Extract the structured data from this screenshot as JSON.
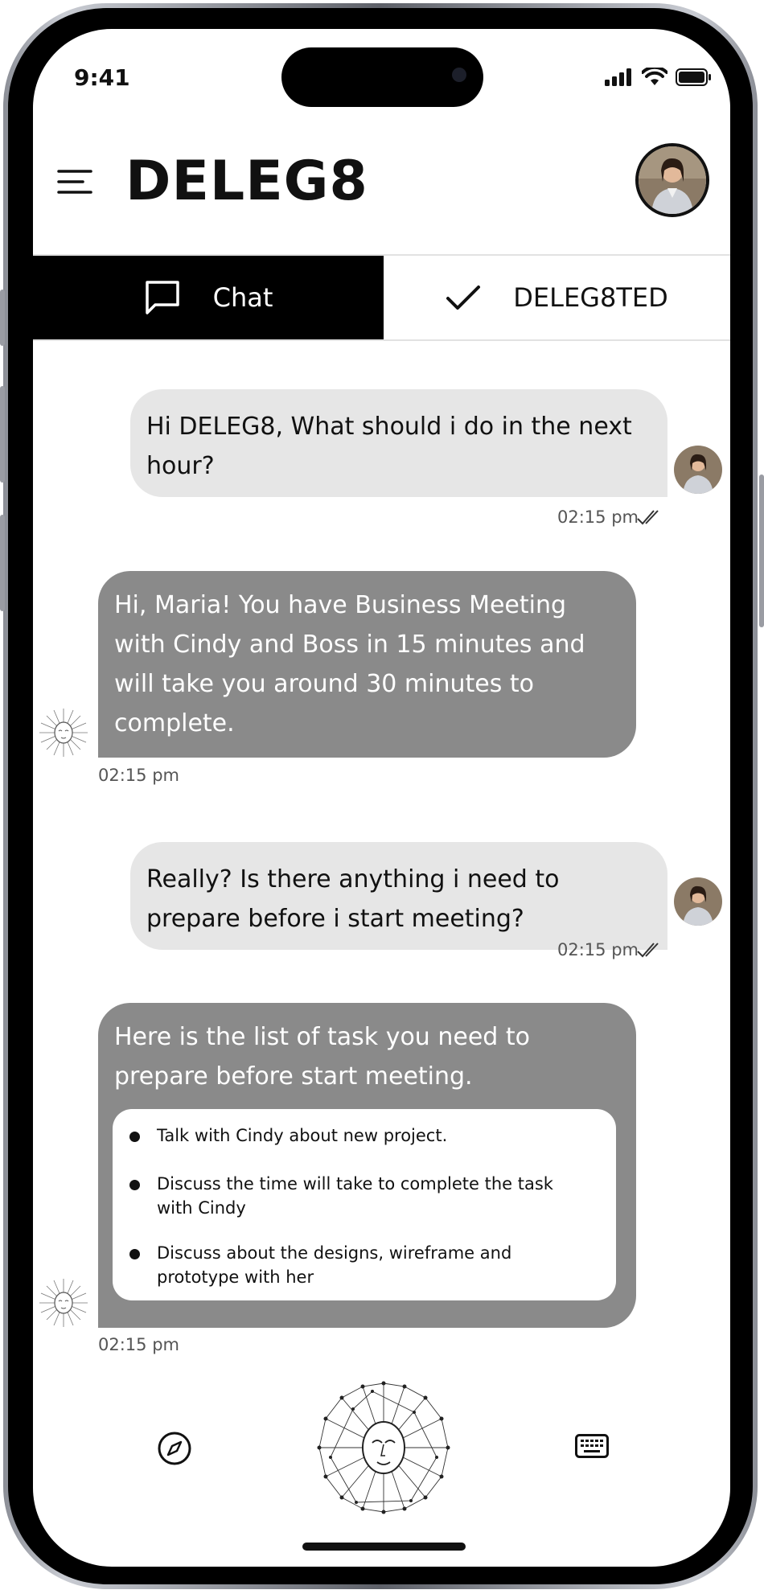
{
  "status_bar": {
    "time": "9:41"
  },
  "app": {
    "brand": "DELEG8"
  },
  "tabs": [
    {
      "label": "Chat",
      "active": true
    },
    {
      "label": "DELEG8TED",
      "active": false
    }
  ],
  "messages": [
    {
      "sender": "user",
      "text": "Hi DELEG8, What should i do in the next hour?",
      "time": "02:15 pm"
    },
    {
      "sender": "bot",
      "text": "Hi, Maria! You have Business Meeting with Cindy and Boss in 15 minutes and will take you around 30 minutes to complete.",
      "time": "02:15 pm"
    },
    {
      "sender": "user",
      "text": "Really? Is there anything i need to prepare before i start meeting?",
      "time": "02:15 pm"
    },
    {
      "sender": "bot",
      "text": "Here is the list of task you need to prepare before start meeting.",
      "time": "02:15 pm",
      "tasks": [
        "Talk with Cindy about new project.",
        "Discuss the time will take to complete the task with Cindy",
        "Discuss about the designs, wireframe and prototype with her"
      ]
    }
  ],
  "bottom_bar": {
    "left_icon": "compass-icon",
    "center_icon": "ai-face-icon",
    "right_icon": "keyboard-icon"
  },
  "colors": {
    "user_bubble": "#e6e6e6",
    "bot_bubble": "#8a8a8a",
    "active_tab": "#000000"
  }
}
